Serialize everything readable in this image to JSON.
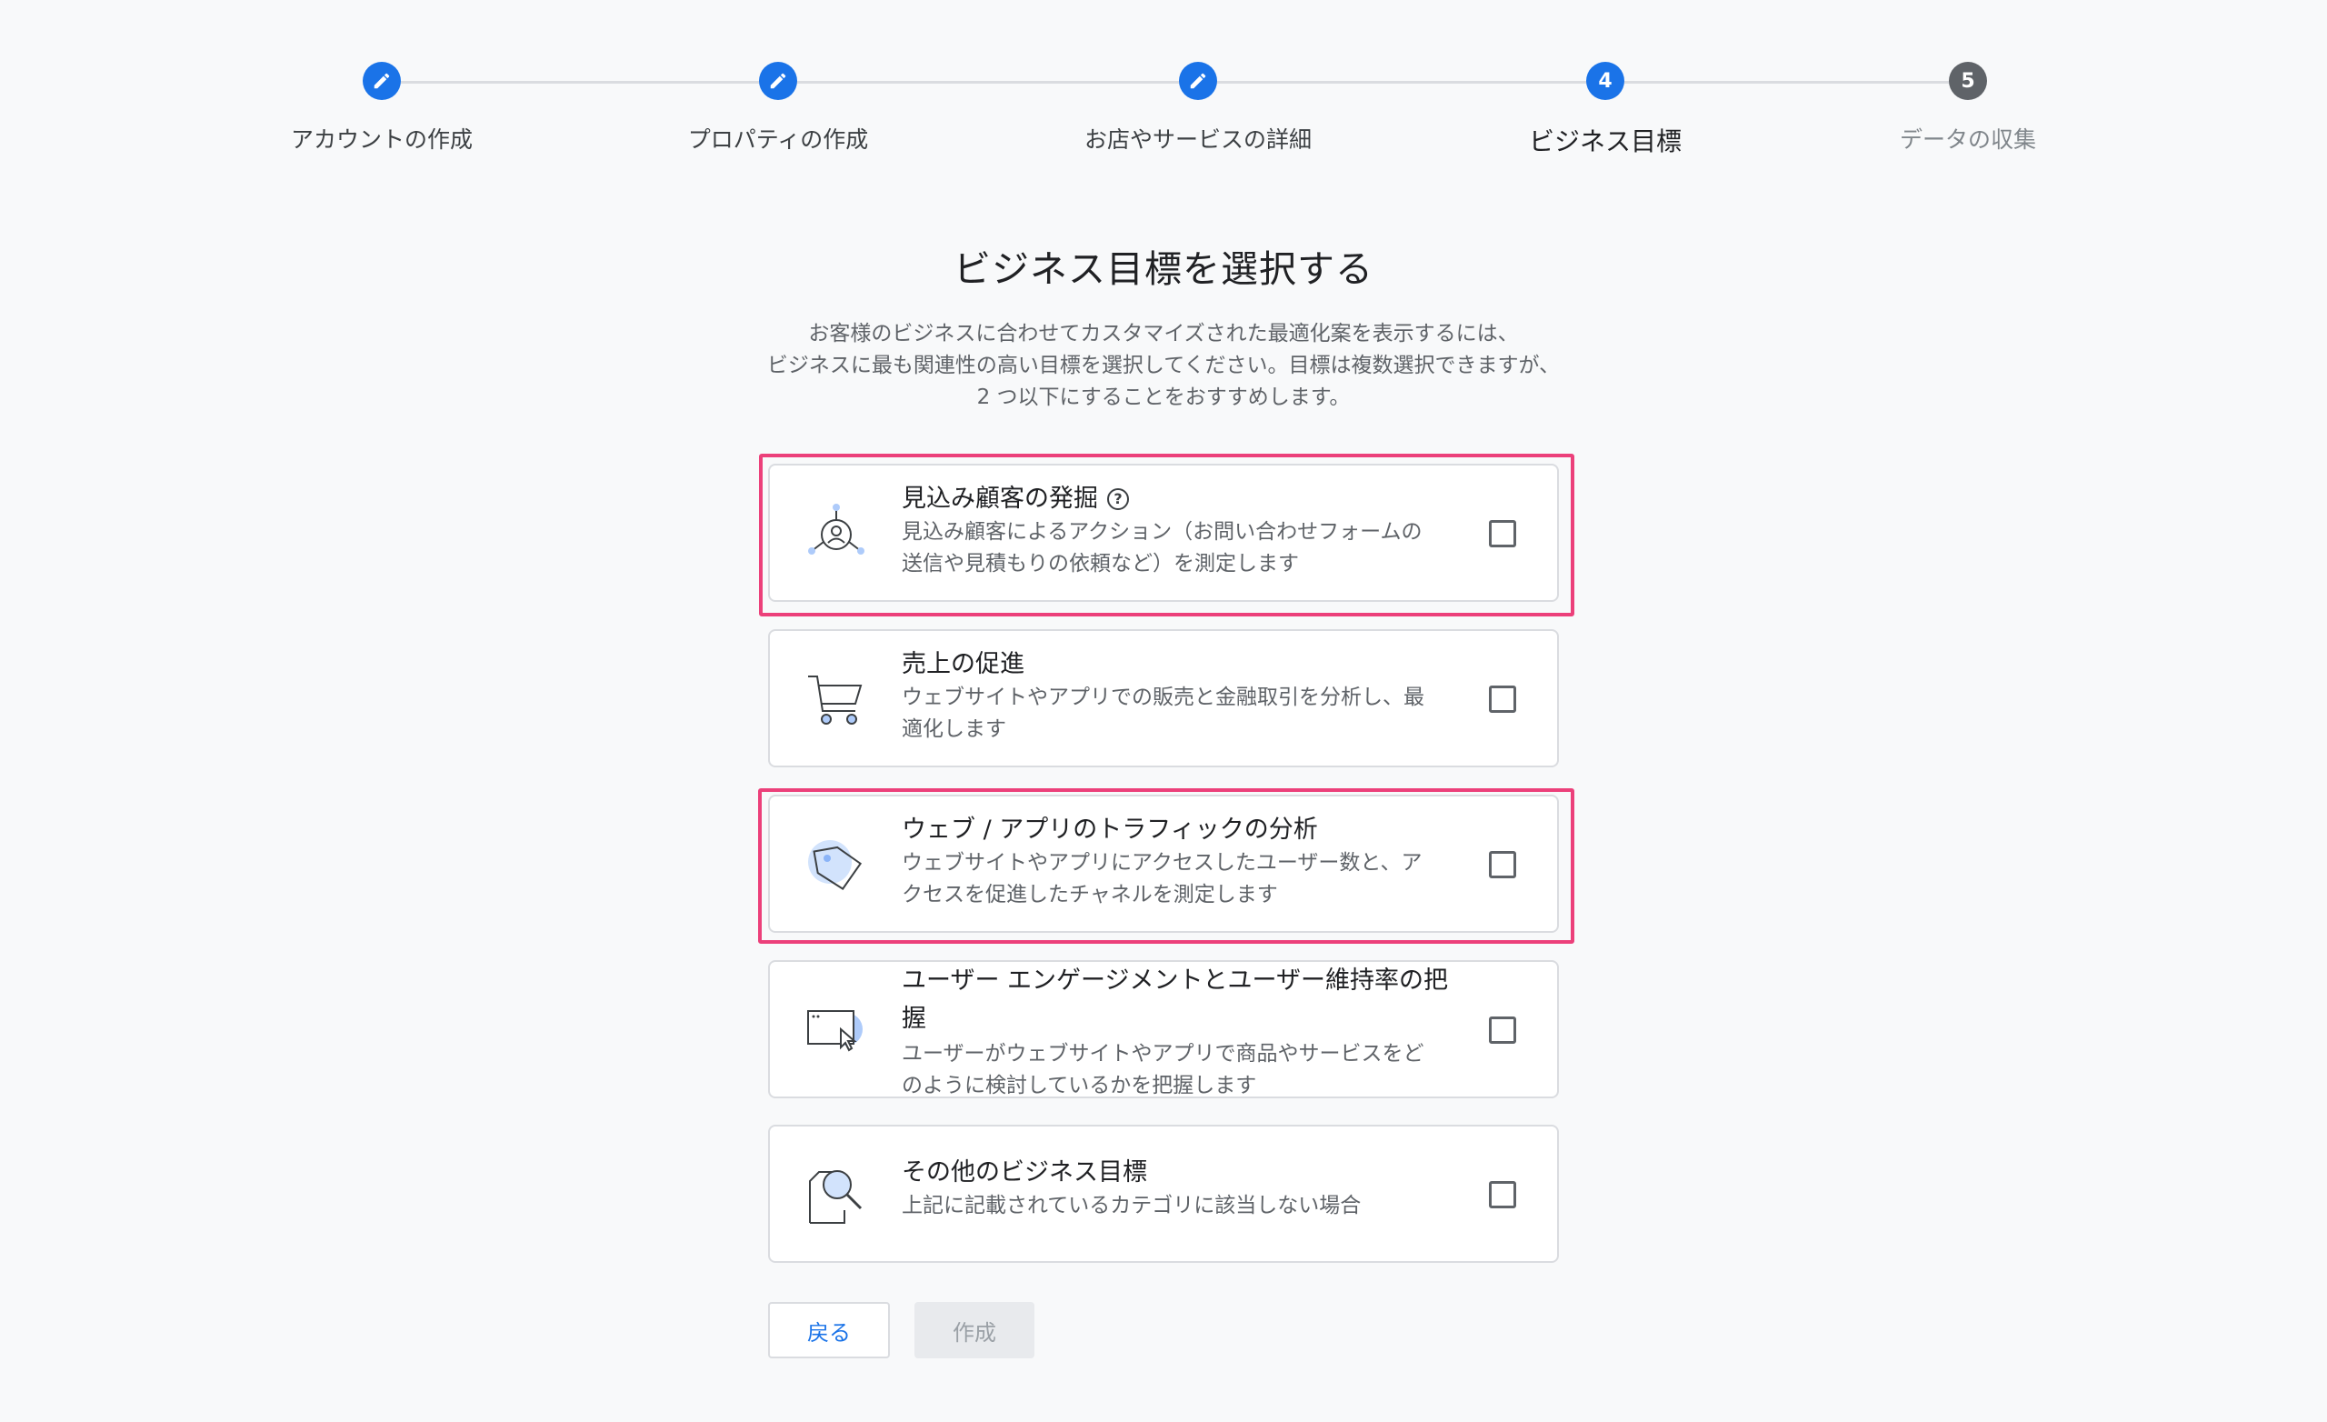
{
  "stepper": {
    "steps": [
      {
        "label": "アカウントの作成",
        "state": "done",
        "icon": "pencil-icon"
      },
      {
        "label": "プロパティの作成",
        "state": "done",
        "icon": "pencil-icon"
      },
      {
        "label": "お店やサービスの詳細",
        "state": "done",
        "icon": "pencil-icon"
      },
      {
        "label": "ビジネス目標",
        "state": "active",
        "number": "4"
      },
      {
        "label": "データの収集",
        "state": "todo",
        "number": "5"
      }
    ]
  },
  "page": {
    "title": "ビジネス目標を選択する",
    "intro_lines": [
      "お客様のビジネスに合わせてカスタマイズされた最適化案を表示するには、",
      "ビジネスに最も関連性の高い目標を選択してください。目標は複数選択できますが、",
      "2 つ以下にすることをおすすめします。"
    ]
  },
  "options": [
    {
      "title": "見込み顧客の発掘",
      "help_icon": "?",
      "desc_lines": [
        "見込み顧客によるアクション（お問い合わせフォームの",
        "送信や見積もりの依頼など）を測定します"
      ],
      "icon": "leads-network-icon",
      "checked": false,
      "highlighted": true
    },
    {
      "title": "売上の促進",
      "desc_lines": [
        "ウェブサイトやアプリでの販売と金融取引を分析し、最",
        "適化します"
      ],
      "icon": "shopping-cart-icon",
      "checked": false,
      "highlighted": false
    },
    {
      "title": "ウェブ / アプリのトラフィックの分析",
      "desc_lines": [
        "ウェブサイトやアプリにアクセスしたユーザー数と、ア",
        "クセスを促進したチャネルを測定します"
      ],
      "icon": "price-tag-icon",
      "checked": false,
      "highlighted": true
    },
    {
      "title_lines": [
        "ユーザー エンゲージメントとユーザー維持率の把",
        "握"
      ],
      "desc_lines": [
        "ユーザーがウェブサイトやアプリで商品やサービスをど",
        "のように検討しているかを把握します"
      ],
      "icon": "browser-cursor-icon",
      "checked": false,
      "highlighted": false
    },
    {
      "title": "その他のビジネス目標",
      "desc_lines": [
        "上記に記載されているカテゴリに該当しない場合"
      ],
      "icon": "document-magnifier-icon",
      "checked": false,
      "highlighted": false
    }
  ],
  "buttons": {
    "back_label": "戻る",
    "create_label": "作成"
  },
  "colors": {
    "accent": "#1a73e8",
    "highlight": "#ec407a",
    "muted": "#5f6368"
  }
}
